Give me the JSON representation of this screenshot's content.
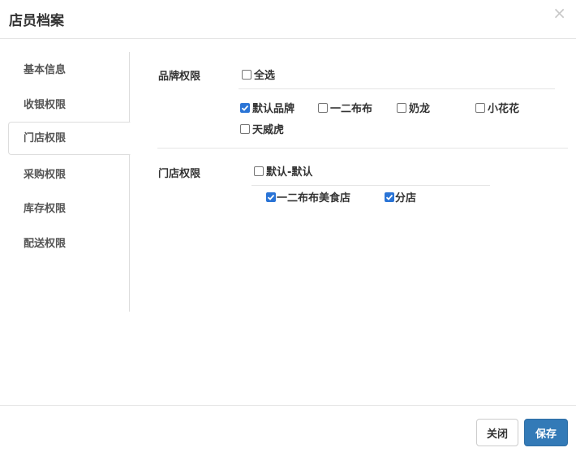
{
  "dialog": {
    "title": "店员档案",
    "close_icon": "×"
  },
  "nav": {
    "items": [
      {
        "label": "基本信息",
        "active": false
      },
      {
        "label": "收银权限",
        "active": false
      },
      {
        "label": "门店权限",
        "active": true
      },
      {
        "label": "采购权限",
        "active": false
      },
      {
        "label": "库存权限",
        "active": false
      },
      {
        "label": "配送权限",
        "active": false
      }
    ]
  },
  "brand": {
    "label": "品牌权限",
    "select_all": {
      "label": "全选",
      "checked": false
    },
    "options": [
      {
        "label": "默认品牌",
        "checked": true
      },
      {
        "label": "一二布布",
        "checked": false
      },
      {
        "label": "奶龙",
        "checked": false
      },
      {
        "label": "小花花",
        "checked": false
      },
      {
        "label": "天威虎",
        "checked": false
      }
    ]
  },
  "store": {
    "label": "门店权限",
    "group": {
      "label": "默认-默认",
      "checked": false
    },
    "options": [
      {
        "label": "一二布布美食店",
        "checked": true
      },
      {
        "label": "分店",
        "checked": true
      }
    ]
  },
  "footer": {
    "close_label": "关闭",
    "save_label": "保存"
  },
  "colors": {
    "primary": "#337ab7",
    "check": "#2a74d6"
  }
}
